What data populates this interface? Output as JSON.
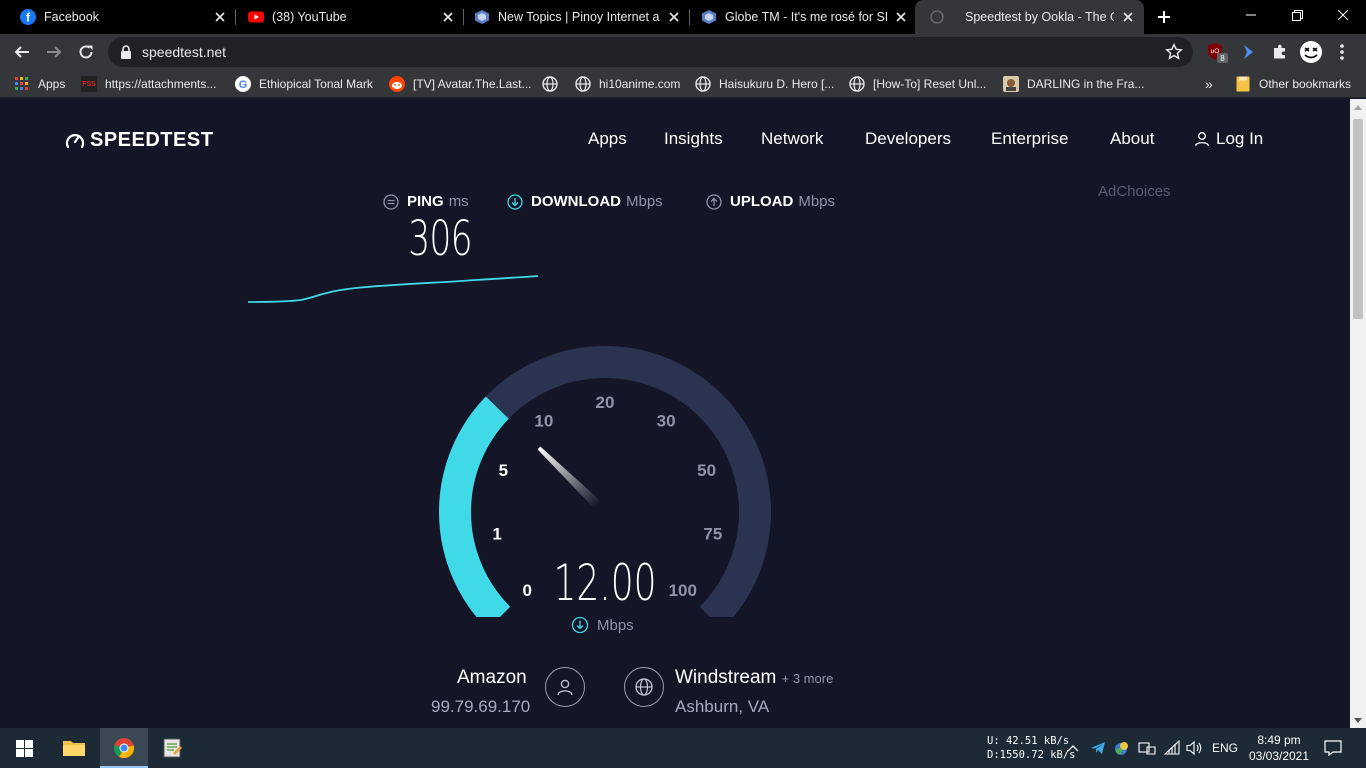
{
  "tabs": [
    {
      "title": "Facebook",
      "icon": "facebook-icon"
    },
    {
      "title": "(38) YouTube",
      "icon": "youtube-icon"
    },
    {
      "title": "New Topics | Pinoy Internet an",
      "icon": "forum-icon"
    },
    {
      "title": "Globe TM - It's me rosé for SH",
      "icon": "forum-icon"
    },
    {
      "title": "Speedtest by Ookla - The Glob",
      "icon": "speedtest-icon"
    }
  ],
  "address_bar": {
    "url": "speedtest.net"
  },
  "bookmarks": [
    {
      "label": "Apps"
    },
    {
      "label": "https://attachments..."
    },
    {
      "label": "Ethiopical Tonal Mark"
    },
    {
      "label": "[TV] Avatar.The.Last..."
    },
    {
      "label": ""
    },
    {
      "label": "hi10anime.com"
    },
    {
      "label": "Haisukuru D. Hero [..."
    },
    {
      "label": "[How-To] Reset Unl..."
    },
    {
      "label": "DARLING in the Fra..."
    }
  ],
  "bookmarks_overflow": "»",
  "other_bookmarks": "Other bookmarks",
  "extension_badge": "8",
  "site": {
    "logo": "SPEEDTEST",
    "nav": [
      "Apps",
      "Insights",
      "Network",
      "Developers",
      "Enterprise",
      "About"
    ],
    "login": "Log In",
    "adchoices": "AdChoices"
  },
  "metrics": {
    "ping_label": "PING",
    "ping_unit": "ms",
    "ping_value": "306",
    "download_label": "DOWNLOAD",
    "download_unit": "Mbps",
    "upload_label": "UPLOAD",
    "upload_unit": "Mbps"
  },
  "gauge": {
    "ticks": [
      "0",
      "1",
      "5",
      "10",
      "20",
      "30",
      "50",
      "75",
      "100"
    ],
    "current_value": "12.00",
    "unit": "Mbps",
    "fill_fraction": 0.33,
    "accent_color": "#3fd9e8",
    "track_color": "#2a3450"
  },
  "provider": {
    "name": "Amazon",
    "ip": "99.79.69.170"
  },
  "server": {
    "name": "Windstream",
    "more": "+ 3 more",
    "location": "Ashburn, VA"
  },
  "taskbar": {
    "net_up": "U:   42.51 kB/s",
    "net_down": "D:1550.72 kB/s",
    "lang": "ENG",
    "time": "8:49 pm",
    "date": "03/03/2021"
  }
}
